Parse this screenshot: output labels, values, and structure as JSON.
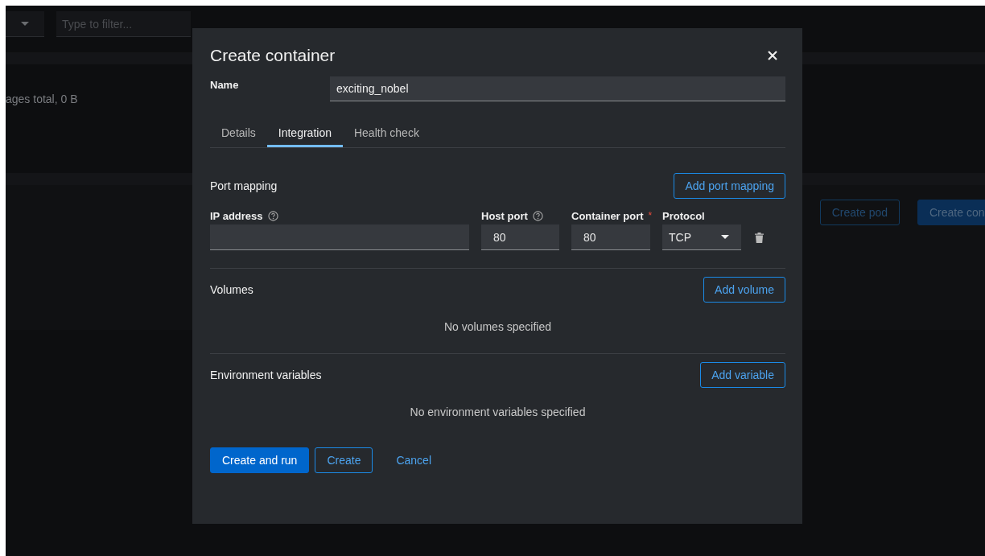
{
  "background": {
    "filter": {
      "placeholder": "Type to filter..."
    },
    "summary": "ages total, 0 B",
    "buttons": [
      {
        "label": "Create pod",
        "kind": "secondary"
      },
      {
        "label": "Create con",
        "kind": "primary"
      }
    ]
  },
  "dialog": {
    "title": "Create container",
    "name_label": "Name",
    "name_value": "exciting_nobel",
    "tabs": [
      {
        "label": "Details",
        "selected": false
      },
      {
        "label": "Integration",
        "selected": true
      },
      {
        "label": "Health check",
        "selected": false
      }
    ],
    "port_mapping": {
      "title": "Port mapping",
      "add_button": "Add port mapping",
      "columns": [
        {
          "label": "IP address",
          "kind": "help"
        },
        {
          "label": "Host port",
          "kind": "help"
        },
        {
          "label": "Container port",
          "kind": "required",
          "required_mark": "*"
        },
        {
          "label": "Protocol",
          "kind": "plain"
        }
      ],
      "row": {
        "host_port": "80",
        "container_port": "80",
        "protocol": "TCP"
      }
    },
    "volumes": {
      "title": "Volumes",
      "add_button": "Add volume",
      "empty": "No volumes specified"
    },
    "environment": {
      "title": "Environment variables",
      "add_button": "Add variable",
      "empty": "No environment variables specified"
    },
    "footer": [
      {
        "label": "Create and run",
        "kind": "primary"
      },
      {
        "label": "Create",
        "kind": "secondary"
      },
      {
        "label": "Cancel",
        "kind": "link"
      }
    ]
  }
}
